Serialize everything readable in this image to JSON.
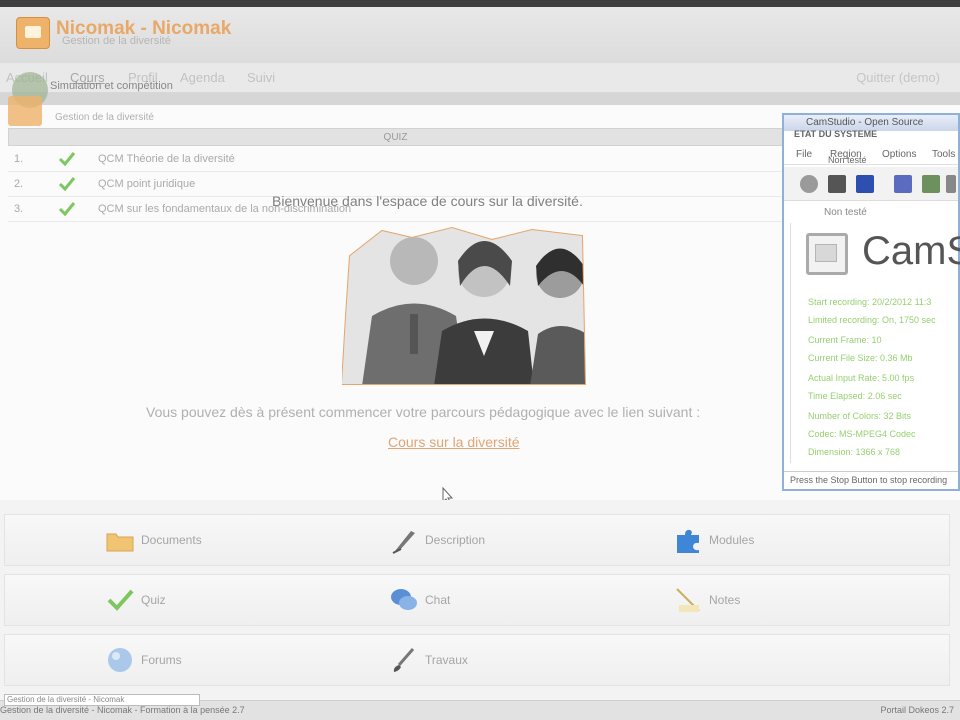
{
  "app": {
    "title": "Nicomak - Nicomak",
    "subtitle": "Gestion de la diversité"
  },
  "nav": {
    "items": [
      "Accueil",
      "Cours",
      "Profil",
      "Agenda",
      "Suivi"
    ],
    "quit": "Quitter (demo)"
  },
  "overlay": {
    "ghost_text": "Simulation et compétition"
  },
  "breadcrumb": "Gestion de la diversité",
  "quiz": {
    "header": "QUIZ",
    "rows": [
      {
        "num": "1.",
        "label": "QCM Théorie de la diversité"
      },
      {
        "num": "2.",
        "label": "QCM point juridique"
      },
      {
        "num": "3.",
        "label": "QCM sur les fondamentaux de la non-discrimination"
      }
    ]
  },
  "welcome": "Bienvenue dans l'espace de cours sur la diversité.",
  "intro": "Vous pouvez dès à présent commencer votre parcours pédagogique avec le lien suivant :",
  "course_link": "Cours sur la diversité",
  "camstudio": {
    "title": "CamStudio - Open Source",
    "ghost_title": "ETAT DU SYSTEME",
    "menu": [
      "File",
      "Region",
      "Options",
      "Tools"
    ],
    "submenu": "Non testé",
    "status_top": "Non testé",
    "brand": "CamS",
    "info": [
      "Start recording: 20/2/2012  11:3",
      "Limited recording: On, 1750 sec",
      "Current Frame: 10",
      "Current File Size: 0.36 Mb",
      "Actual Input Rate: 5.00 fps",
      "Time Elapsed: 2.06 sec",
      "Number of Colors: 32 Bits",
      "Codec: MS-MPEG4 Codec",
      "Dimension: 1366 x 768"
    ],
    "footer": "Press the Stop Button to stop recording"
  },
  "tools": {
    "row1": [
      "Documents",
      "Description",
      "Modules"
    ],
    "row2": [
      "Quiz",
      "Chat",
      "Notes"
    ],
    "row3": [
      "Forums",
      "Travaux"
    ]
  },
  "statusbar": {
    "left": "Gestion de la diversité - Nicomak - Formation à la pensée 2.7",
    "right": "Portail Dokeos 2.7",
    "tip": "Gestion de la diversité - Nicomak"
  },
  "colors": {
    "accent": "#dfa575",
    "cam_info": "#95d06f",
    "cam_border": "#8fb0d8"
  }
}
